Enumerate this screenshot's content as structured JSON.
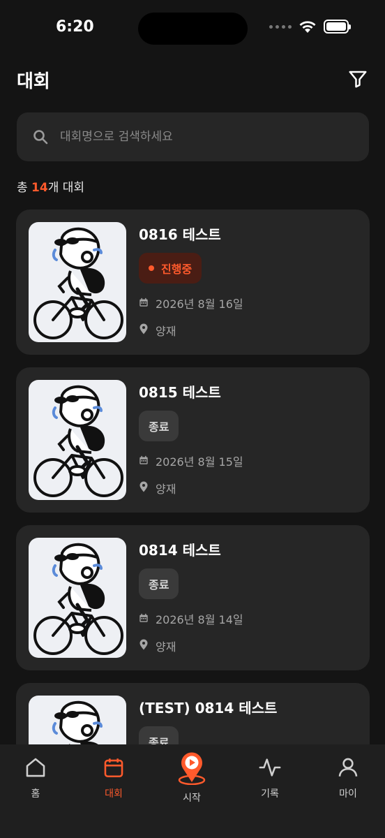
{
  "status_bar": {
    "time": "6:20"
  },
  "header": {
    "title": "대회",
    "filter_icon": "filter-icon"
  },
  "search": {
    "placeholder": "대회명으로 검색하세요",
    "value": ""
  },
  "summary": {
    "prefix": "총 ",
    "count": "14",
    "suffix": "개 대회"
  },
  "cards": [
    {
      "title": "0816 테스트",
      "status": "진행중",
      "status_type": "live",
      "date": "2026년 8월 16일",
      "location": "양재"
    },
    {
      "title": "0815 테스트",
      "status": "종료",
      "status_type": "done",
      "date": "2026년 8월 15일",
      "location": "양재"
    },
    {
      "title": "0814 테스트",
      "status": "종료",
      "status_type": "done",
      "date": "2026년 8월 14일",
      "location": "양재"
    },
    {
      "title": "(TEST) 0814 테스트",
      "status": "종료",
      "status_type": "done",
      "date": "",
      "location": ""
    }
  ],
  "tabs": [
    {
      "label": "홈",
      "icon": "home-icon",
      "active": false
    },
    {
      "label": "대회",
      "icon": "calendar-icon",
      "active": true
    },
    {
      "label": "시작",
      "icon": "start-icon",
      "active": false
    },
    {
      "label": "기록",
      "icon": "activity-icon",
      "active": false
    },
    {
      "label": "마이",
      "icon": "profile-icon",
      "active": false
    }
  ],
  "colors": {
    "accent": "#ff5a2c",
    "background": "#141414",
    "card": "#262626"
  }
}
